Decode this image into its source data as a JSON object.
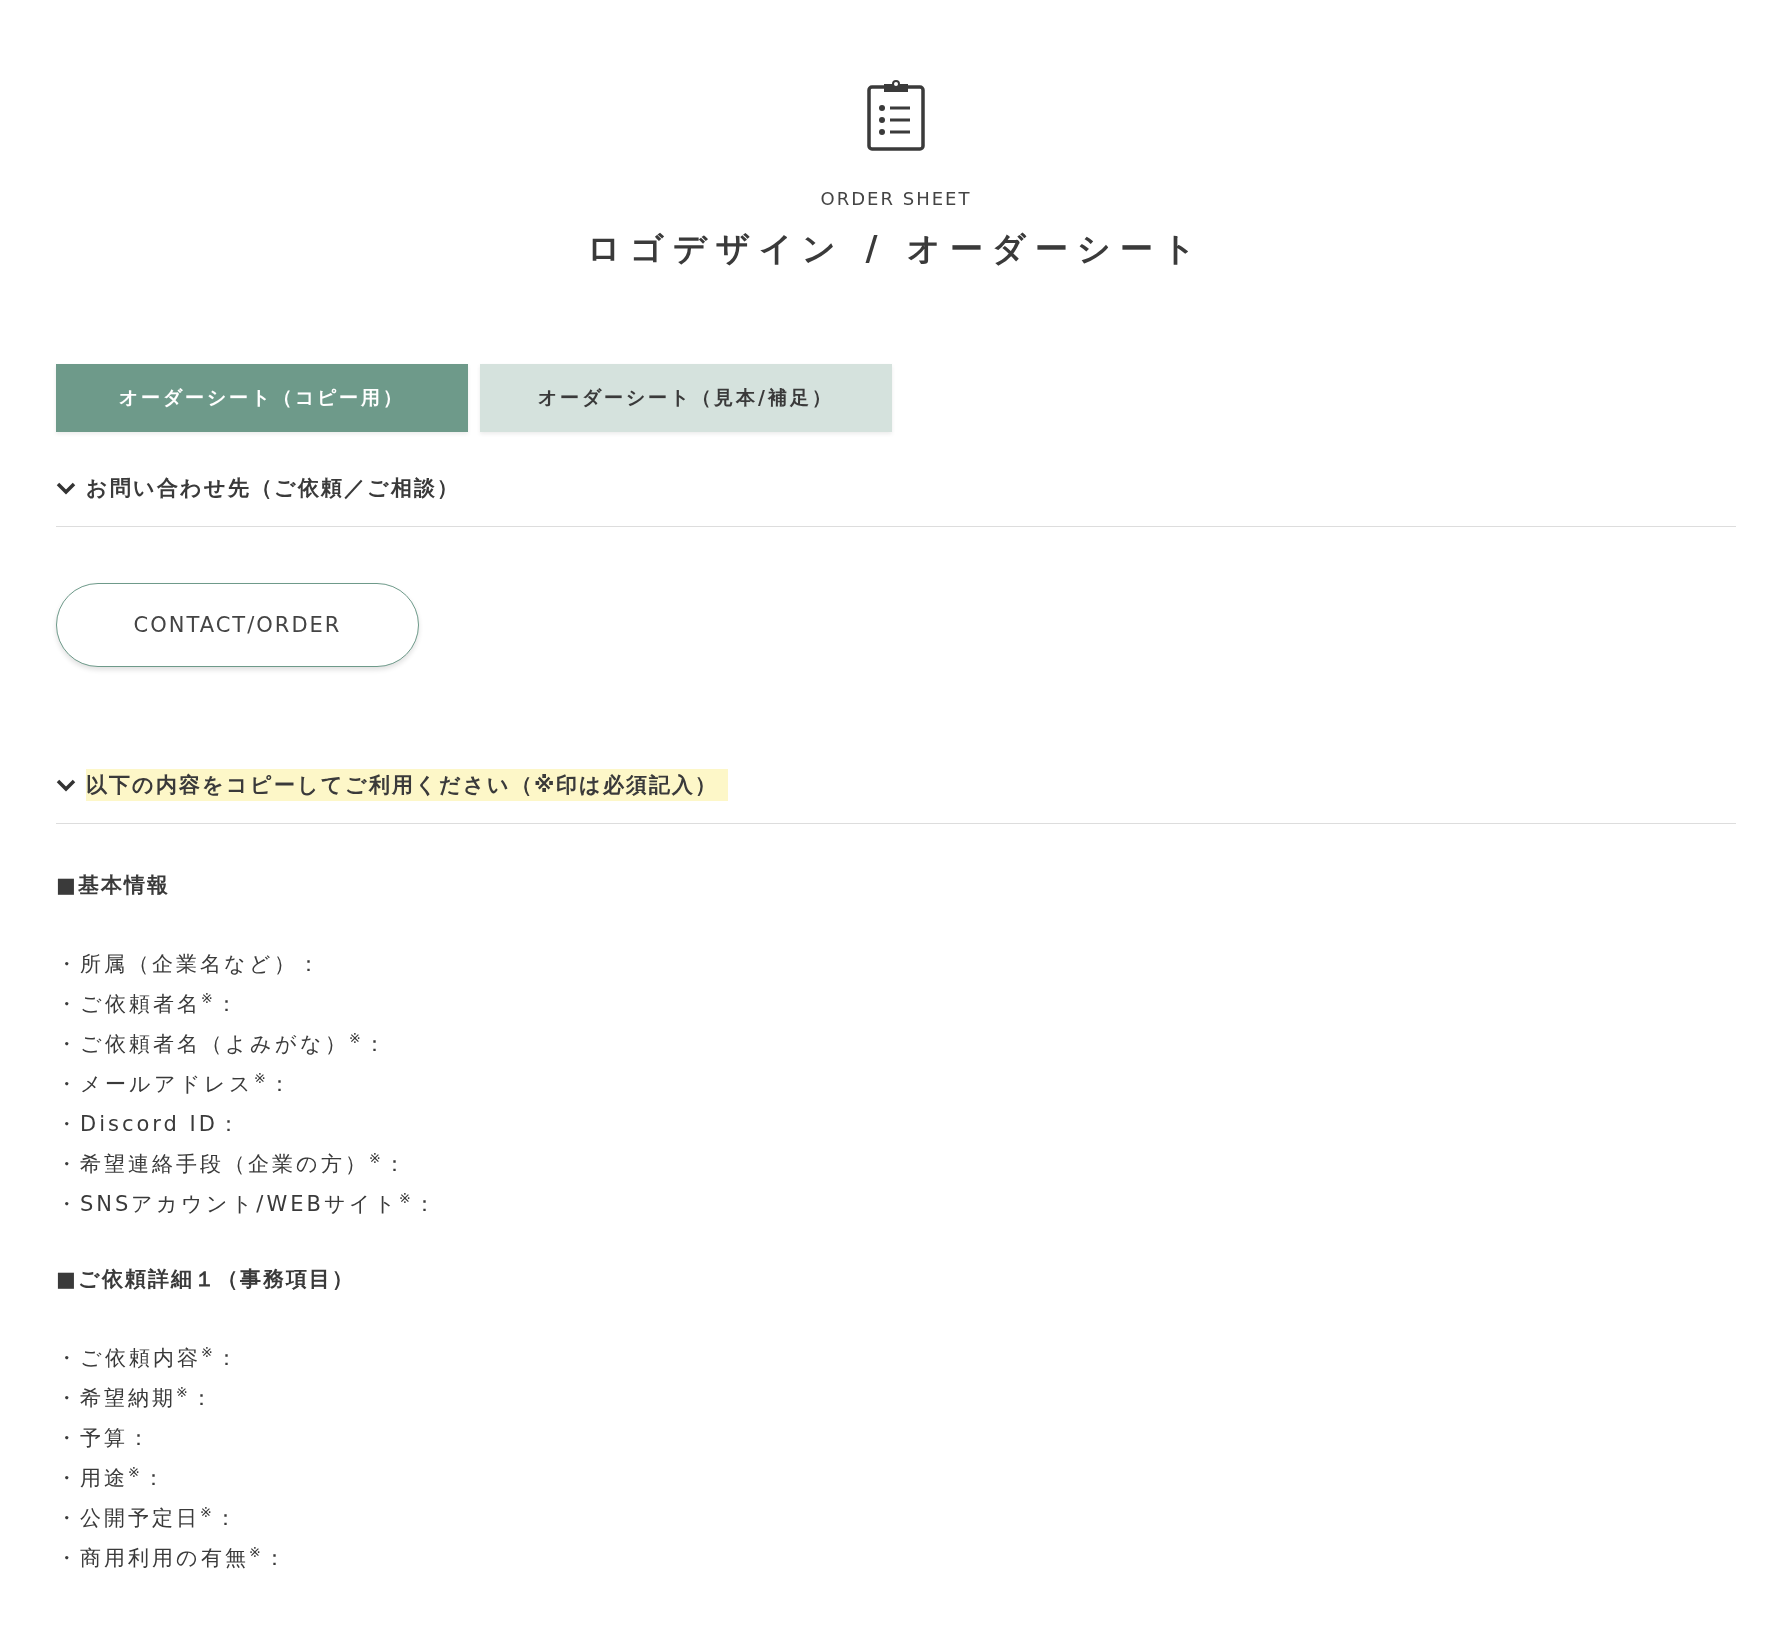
{
  "header": {
    "eyebrow": "ORDER SHEET",
    "title": "ロゴデザイン / オーダーシート"
  },
  "tabs": [
    {
      "label": "オーダーシート（コピー用）",
      "selected": true
    },
    {
      "label": "オーダーシート（見本/補足）",
      "selected": false
    }
  ],
  "sections": [
    {
      "title": "お問い合わせ先（ご依頼／ご相談）",
      "expanded": true,
      "highlighted": false,
      "button": "CONTACT/ORDER"
    },
    {
      "title": "以下の内容をコピーしてご利用ください（※印は必須記入）",
      "expanded": true,
      "highlighted": true,
      "lines": [
        {
          "kind": "heading",
          "text": "■基本情報"
        },
        {
          "kind": "item",
          "text": "・所属（企業名など）："
        },
        {
          "kind": "item",
          "text": "・ご依頼者名$^{※}$："
        },
        {
          "kind": "item",
          "text": "・ご依頼者名（よみがな）$^{※}$："
        },
        {
          "kind": "item",
          "text": "・メールアドレス$^{※}$："
        },
        {
          "kind": "item",
          "text": "・Discord ID："
        },
        {
          "kind": "item",
          "text": "・希望連絡手段（企業の方）$^{※}$："
        },
        {
          "kind": "item",
          "text": "・SNSアカウント/WEBサイト$^{※}$："
        },
        {
          "kind": "heading",
          "text": "■ご依頼詳細１（事務項目）"
        },
        {
          "kind": "item",
          "text": "・ご依頼内容$^{※}$："
        },
        {
          "kind": "item",
          "text": "・希望納期$^{※}$："
        },
        {
          "kind": "item",
          "text": "・予算："
        },
        {
          "kind": "item",
          "text": "・用途$^{※}$："
        },
        {
          "kind": "item",
          "text": "・公開予定日$^{※}$："
        },
        {
          "kind": "item",
          "text": "・商用利用の有無$^{※}$："
        }
      ]
    }
  ]
}
